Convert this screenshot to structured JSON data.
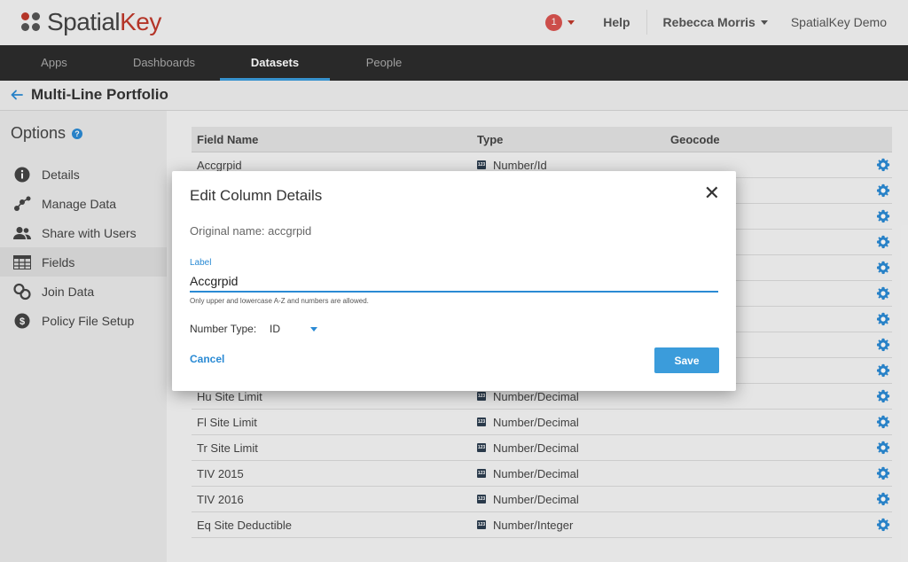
{
  "header": {
    "logo_part1": "Spatial",
    "logo_part2": "Key",
    "notification_count": "1",
    "help_label": "Help",
    "user_name": "Rebecca Morris",
    "org_name": "SpatialKey Demo"
  },
  "nav": {
    "items": [
      {
        "label": "Apps"
      },
      {
        "label": "Dashboards"
      },
      {
        "label": "Datasets",
        "active": true
      },
      {
        "label": "People"
      }
    ]
  },
  "page": {
    "title": "Multi-Line Portfolio"
  },
  "sidebar": {
    "title": "Options",
    "help_glyph": "?",
    "items": [
      {
        "label": "Details",
        "icon": "info-icon"
      },
      {
        "label": "Manage Data",
        "icon": "network-icon"
      },
      {
        "label": "Share with Users",
        "icon": "users-icon"
      },
      {
        "label": "Fields",
        "icon": "table-icon",
        "active": true
      },
      {
        "label": "Join Data",
        "icon": "join-icon"
      },
      {
        "label": "Policy File Setup",
        "icon": "dollar-icon"
      }
    ]
  },
  "table": {
    "headers": {
      "field": "Field Name",
      "type": "Type",
      "geocode": "Geocode"
    },
    "type_icon_text": "123",
    "rows": [
      {
        "field": "Accgrpid",
        "type": "Number/Id"
      },
      {
        "field": "",
        "type": ""
      },
      {
        "field": "",
        "type": ""
      },
      {
        "field": "",
        "type": ""
      },
      {
        "field": "",
        "type": ""
      },
      {
        "field": "",
        "type": ""
      },
      {
        "field": "",
        "type": ""
      },
      {
        "field": "",
        "type": ""
      },
      {
        "field": "",
        "type": ""
      },
      {
        "field": "Hu Site Limit",
        "type": "Number/Decimal"
      },
      {
        "field": "Fl Site Limit",
        "type": "Number/Decimal"
      },
      {
        "field": "Tr Site Limit",
        "type": "Number/Decimal"
      },
      {
        "field": "TIV 2015",
        "type": "Number/Decimal"
      },
      {
        "field": "TIV 2016",
        "type": "Number/Decimal"
      },
      {
        "field": "Eq Site Deductible",
        "type": "Number/Integer"
      }
    ]
  },
  "modal": {
    "title": "Edit Column Details",
    "close_glyph": "✕",
    "original_name": "Original name: accgrpid",
    "label_caption": "Label",
    "label_value": "Accgrpid",
    "hint": "Only upper and lowercase A-Z and numbers are allowed.",
    "number_type_label": "Number Type:",
    "number_type_value": "ID",
    "cancel_label": "Cancel",
    "save_label": "Save"
  },
  "colors": {
    "accent": "#3b9cdb",
    "brand_red": "#c0392b",
    "nav_bg": "#2c2c2c"
  }
}
